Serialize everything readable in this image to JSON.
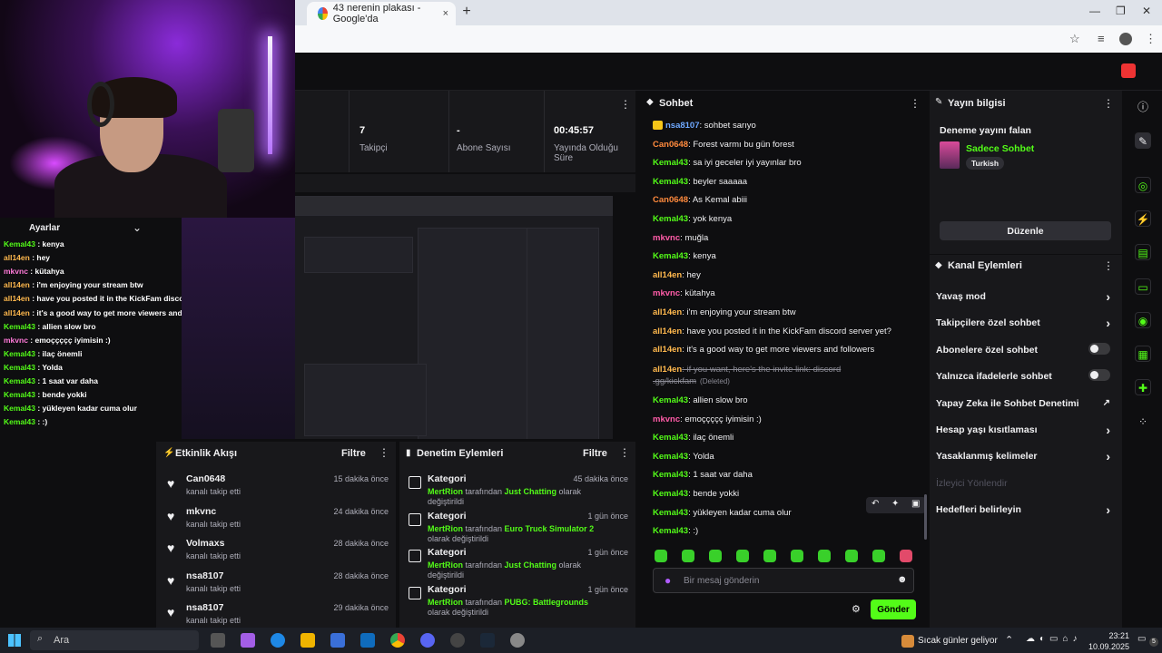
{
  "browser": {
    "tab_title": "43 nerenin plakası - Google'da",
    "tab_close": "×",
    "new_tab": "+"
  },
  "overlay_chat": {
    "header": "Ayarlar",
    "lines": [
      {
        "user": "Kemal43",
        "msg": "kenya",
        "color": "#53fc18"
      },
      {
        "user": "all14en",
        "msg": "hey",
        "color": "#ffb84d"
      },
      {
        "user": "mkvnc",
        "msg": "kütahya",
        "color": "#ff7ad9"
      },
      {
        "user": "all14en",
        "msg": "i'm enjoying your stream btw",
        "color": "#ffb84d"
      },
      {
        "user": "all14en",
        "msg": "have you posted it in the KickFam discord server yet?",
        "color": "#ffb84d"
      },
      {
        "user": "all14en",
        "msg": "it's a good way to get more viewers and followers",
        "color": "#ffb84d"
      },
      {
        "user": "Kemal43",
        "msg": "allien slow bro",
        "color": "#53fc18"
      },
      {
        "user": "mkvnc",
        "msg": "emoççççç iyimisin :)",
        "color": "#ff7ad9"
      },
      {
        "user": "Kemal43",
        "msg": "ilaç önemli",
        "color": "#53fc18"
      },
      {
        "user": "Kemal43",
        "msg": "Yolda",
        "color": "#53fc18"
      },
      {
        "user": "Kemal43",
        "msg": "1 saat var daha",
        "color": "#53fc18"
      },
      {
        "user": "Kemal43",
        "msg": "bende yokki",
        "color": "#53fc18"
      },
      {
        "user": "Kemal43",
        "msg": "yükleyen kadar cuma olur",
        "color": "#53fc18"
      },
      {
        "user": "Kemal43",
        "msg": ":)",
        "color": "#53fc18"
      }
    ]
  },
  "stats": {
    "followers_value": "7",
    "followers_label": "Takipçi",
    "subs_value": "-",
    "subs_label": "Abone Sayısı",
    "uptime_value": "00:45:57",
    "uptime_label_1": "Yayında Olduğu",
    "uptime_label_2": "Süre"
  },
  "activity": {
    "title": "Etkinlik Akışı",
    "filter": "Filtre",
    "items": [
      {
        "user": "Can0648",
        "sub": "kanalı takip etti",
        "time": "15 dakika önce"
      },
      {
        "user": "mkvnc",
        "sub": "kanalı takip etti",
        "time": "24 dakika önce"
      },
      {
        "user": "Volmaxs",
        "sub": "kanalı takip etti",
        "time": "28 dakika önce"
      },
      {
        "user": "nsa8107",
        "sub": "kanalı takip etti",
        "time": "28 dakika önce"
      },
      {
        "user": "nsa8107",
        "sub": "kanalı takip etti",
        "time": "29 dakika önce"
      }
    ]
  },
  "moderation": {
    "title": "Denetim Eylemleri",
    "filter": "Filtre",
    "items": [
      {
        "title": "Kategori",
        "time": "45 dakika önce",
        "actor": "MertRion",
        "mid": " tarafından ",
        "cat": "Just Chatting",
        "tail": " olarak değiştirildi"
      },
      {
        "title": "Kategori",
        "time": "1 gün önce",
        "actor": "MertRion",
        "mid": " tarafından ",
        "cat": "Euro Truck Simulator 2",
        "tail": " olarak değiştirildi"
      },
      {
        "title": "Kategori",
        "time": "1 gün önce",
        "actor": "MertRion",
        "mid": " tarafından ",
        "cat": "Just Chatting",
        "tail": " olarak değiştirildi"
      },
      {
        "title": "Kategori",
        "time": "1 gün önce",
        "actor": "MertRion",
        "mid": " tarafından ",
        "cat": "PUBG: Battlegrounds",
        "tail": " olarak değiştirildi"
      }
    ]
  },
  "chat": {
    "title": "Sohbet",
    "messages": [
      {
        "user": "nsa8107",
        "msg": "sohbet sarıyo",
        "color": "#6ea8ff"
      },
      {
        "user": "Can0648",
        "msg": "Forest varmı bu gün forest",
        "color": "#ff8a3d"
      },
      {
        "user": "Kemal43",
        "msg": "sa iyi geceler iyi yayınlar bro",
        "color": "#53fc18"
      },
      {
        "user": "Kemal43",
        "msg": "beyler saaaaa",
        "color": "#53fc18"
      },
      {
        "user": "Can0648",
        "msg": "As Kemal abiii",
        "color": "#ff8a3d"
      },
      {
        "user": "Kemal43",
        "msg": "yok kenya",
        "color": "#53fc18"
      },
      {
        "user": "mkvnc",
        "msg": "muğla",
        "color": "#ff5ca8"
      },
      {
        "user": "Kemal43",
        "msg": "kenya",
        "color": "#53fc18"
      },
      {
        "user": "all14en",
        "msg": "hey",
        "color": "#ffb84d"
      },
      {
        "user": "mkvnc",
        "msg": "kütahya",
        "color": "#ff5ca8"
      },
      {
        "user": "all14en",
        "msg": "i'm enjoying your stream btw",
        "color": "#ffb84d"
      },
      {
        "user": "all14en",
        "msg": "have you posted it in the KickFam discord server yet?",
        "color": "#ffb84d"
      },
      {
        "user": "all14en",
        "msg": "it's a good way to get more viewers and followers",
        "color": "#ffb84d"
      }
    ],
    "deleted": {
      "user": "all14en",
      "msg1": "if you want, here's the invite link: discord",
      "msg2": ".gg/kickfam",
      "tag": "(Deleted)",
      "color": "#ffb84d"
    },
    "messages2": [
      {
        "user": "Kemal43",
        "msg": "allien slow bro",
        "color": "#53fc18"
      },
      {
        "user": "mkvnc",
        "msg": "emoççççç iyimisin :)",
        "color": "#ff5ca8"
      },
      {
        "user": "Kemal43",
        "msg": "ilaç önemli",
        "color": "#53fc18"
      },
      {
        "user": "Kemal43",
        "msg": "Yolda",
        "color": "#53fc18"
      },
      {
        "user": "Kemal43",
        "msg": "1 saat var daha",
        "color": "#53fc18"
      },
      {
        "user": "Kemal43",
        "msg": "bende yokki",
        "color": "#53fc18"
      },
      {
        "user": "Kemal43",
        "msg": "yükleyen kadar cuma olur",
        "color": "#53fc18"
      },
      {
        "user": "Kemal43",
        "msg": ":)",
        "color": "#53fc18"
      }
    ],
    "input_placeholder": "Bir mesaj gönderin",
    "send_label": "Gönder"
  },
  "stream_info": {
    "title": "Yayın bilgisi",
    "stream_title": "Deneme yayını falan",
    "category": "Sadece Sohbet",
    "tag": "Turkish",
    "edit_label": "Düzenle"
  },
  "channel_actions": {
    "title": "Kanal Eylemleri",
    "items": [
      {
        "label": "Yavaş mod",
        "kind": "chevron"
      },
      {
        "label": "Takipçilere özel sohbet",
        "kind": "chevron"
      },
      {
        "label": "Abonelere özel sohbet",
        "kind": "toggle"
      },
      {
        "label": "Yalnızca ifadelerle sohbet",
        "kind": "toggle"
      },
      {
        "label": "Yapay Zeka ile Sohbet Denetimi",
        "kind": "external"
      },
      {
        "label": "Hesap yaşı kısıtlaması",
        "kind": "chevron"
      },
      {
        "label": "Yasaklanmış kelimeler",
        "kind": "chevron"
      },
      {
        "label": "İzleyici Yönlendir",
        "kind": "disabled"
      },
      {
        "label": "Hedefleri belirleyin",
        "kind": "chevron"
      }
    ]
  },
  "taskbar": {
    "search": "Ara",
    "weather": "Sıcak günler geliyor",
    "time": "23:21",
    "date": "10.09.2025",
    "notif": "5"
  }
}
